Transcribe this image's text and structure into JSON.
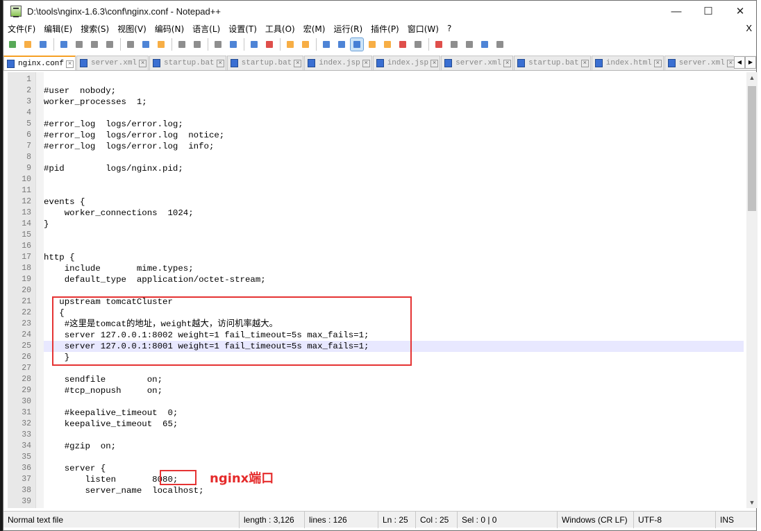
{
  "window": {
    "title": "D:\\tools\\nginx-1.6.3\\conf\\nginx.conf - Notepad++",
    "controls": {
      "minimize": "—",
      "maximize": "☐",
      "close": "✕"
    }
  },
  "menu": {
    "items": [
      "文件(F)",
      "编辑(E)",
      "搜索(S)",
      "视图(V)",
      "编码(N)",
      "语言(L)",
      "设置(T)",
      "工具(O)",
      "宏(M)",
      "运行(R)",
      "插件(P)",
      "窗口(W)",
      "?"
    ],
    "close": "X"
  },
  "toolbar": {
    "icons": [
      "new-file-icon",
      "open-file-icon",
      "save-icon",
      "save-all-icon",
      "close-icon",
      "close-all-icon",
      "print-icon",
      "cut-icon",
      "copy-icon",
      "paste-icon",
      "undo-icon",
      "redo-icon",
      "find-icon",
      "replace-icon",
      "zoom-in-icon",
      "zoom-out-icon",
      "sync-vertical-icon",
      "sync-horizontal-icon",
      "word-wrap-icon",
      "show-all-chars-icon",
      "indent-guide-icon",
      "document-map-icon",
      "function-list-icon",
      "folder-workspace-icon",
      "monitoring-icon",
      "record-macro-icon",
      "stop-macro-icon",
      "play-macro-icon",
      "run-macro-multiple-icon",
      "save-macro-icon"
    ],
    "colors": {
      "red": "#d9302c",
      "blue": "#2f6fcf",
      "green": "#3b9a3b",
      "orange": "#f6a024",
      "gray": "#7a7a7a"
    }
  },
  "tabs": [
    {
      "label": "nginx.conf",
      "active": true
    },
    {
      "label": "server.xml",
      "active": false
    },
    {
      "label": "startup.bat",
      "active": false
    },
    {
      "label": "startup.bat",
      "active": false
    },
    {
      "label": "index.jsp",
      "active": false
    },
    {
      "label": "index.jsp",
      "active": false
    },
    {
      "label": "server.xml",
      "active": false
    },
    {
      "label": "startup.bat",
      "active": false
    },
    {
      "label": "index.html",
      "active": false
    },
    {
      "label": "server.xml",
      "active": false
    },
    {
      "label": "ser",
      "active": false
    }
  ],
  "editor": {
    "first_line": 1,
    "current_line": 25,
    "lines": [
      "",
      "#user  nobody;",
      "worker_processes  1;",
      "",
      "#error_log  logs/error.log;",
      "#error_log  logs/error.log  notice;",
      "#error_log  logs/error.log  info;",
      "",
      "#pid        logs/nginx.pid;",
      "",
      "",
      "events {",
      "    worker_connections  1024;",
      "}",
      "",
      "",
      "http {",
      "    include       mime.types;",
      "    default_type  application/octet-stream;",
      "",
      "   upstream tomcatCluster",
      "   {",
      "    #这里是tomcat的地址，weight越大，访问机率越大。",
      "    server 127.0.0.1:8002 weight=1 fail_timeout=5s max_fails=1;",
      "    server 127.0.0.1:8001 weight=1 fail_timeout=5s max_fails=1;",
      "    }",
      "",
      "    sendfile        on;",
      "    #tcp_nopush     on;",
      "",
      "    #keepalive_timeout  0;",
      "    keepalive_timeout  65;",
      "",
      "    #gzip  on;",
      "",
      "    server {",
      "        listen       8080;",
      "        server_name  localhost;",
      ""
    ]
  },
  "annotation": {
    "label": "nginx端口",
    "color": "#e52b2b"
  },
  "status": {
    "type": "Normal text file",
    "length": "length : 3,126",
    "lines": "lines : 126",
    "ln": "Ln : 25",
    "col": "Col : 25",
    "sel": "Sel : 0 | 0",
    "eol": "Windows (CR LF)",
    "encoding": "UTF-8",
    "mode": "INS"
  }
}
